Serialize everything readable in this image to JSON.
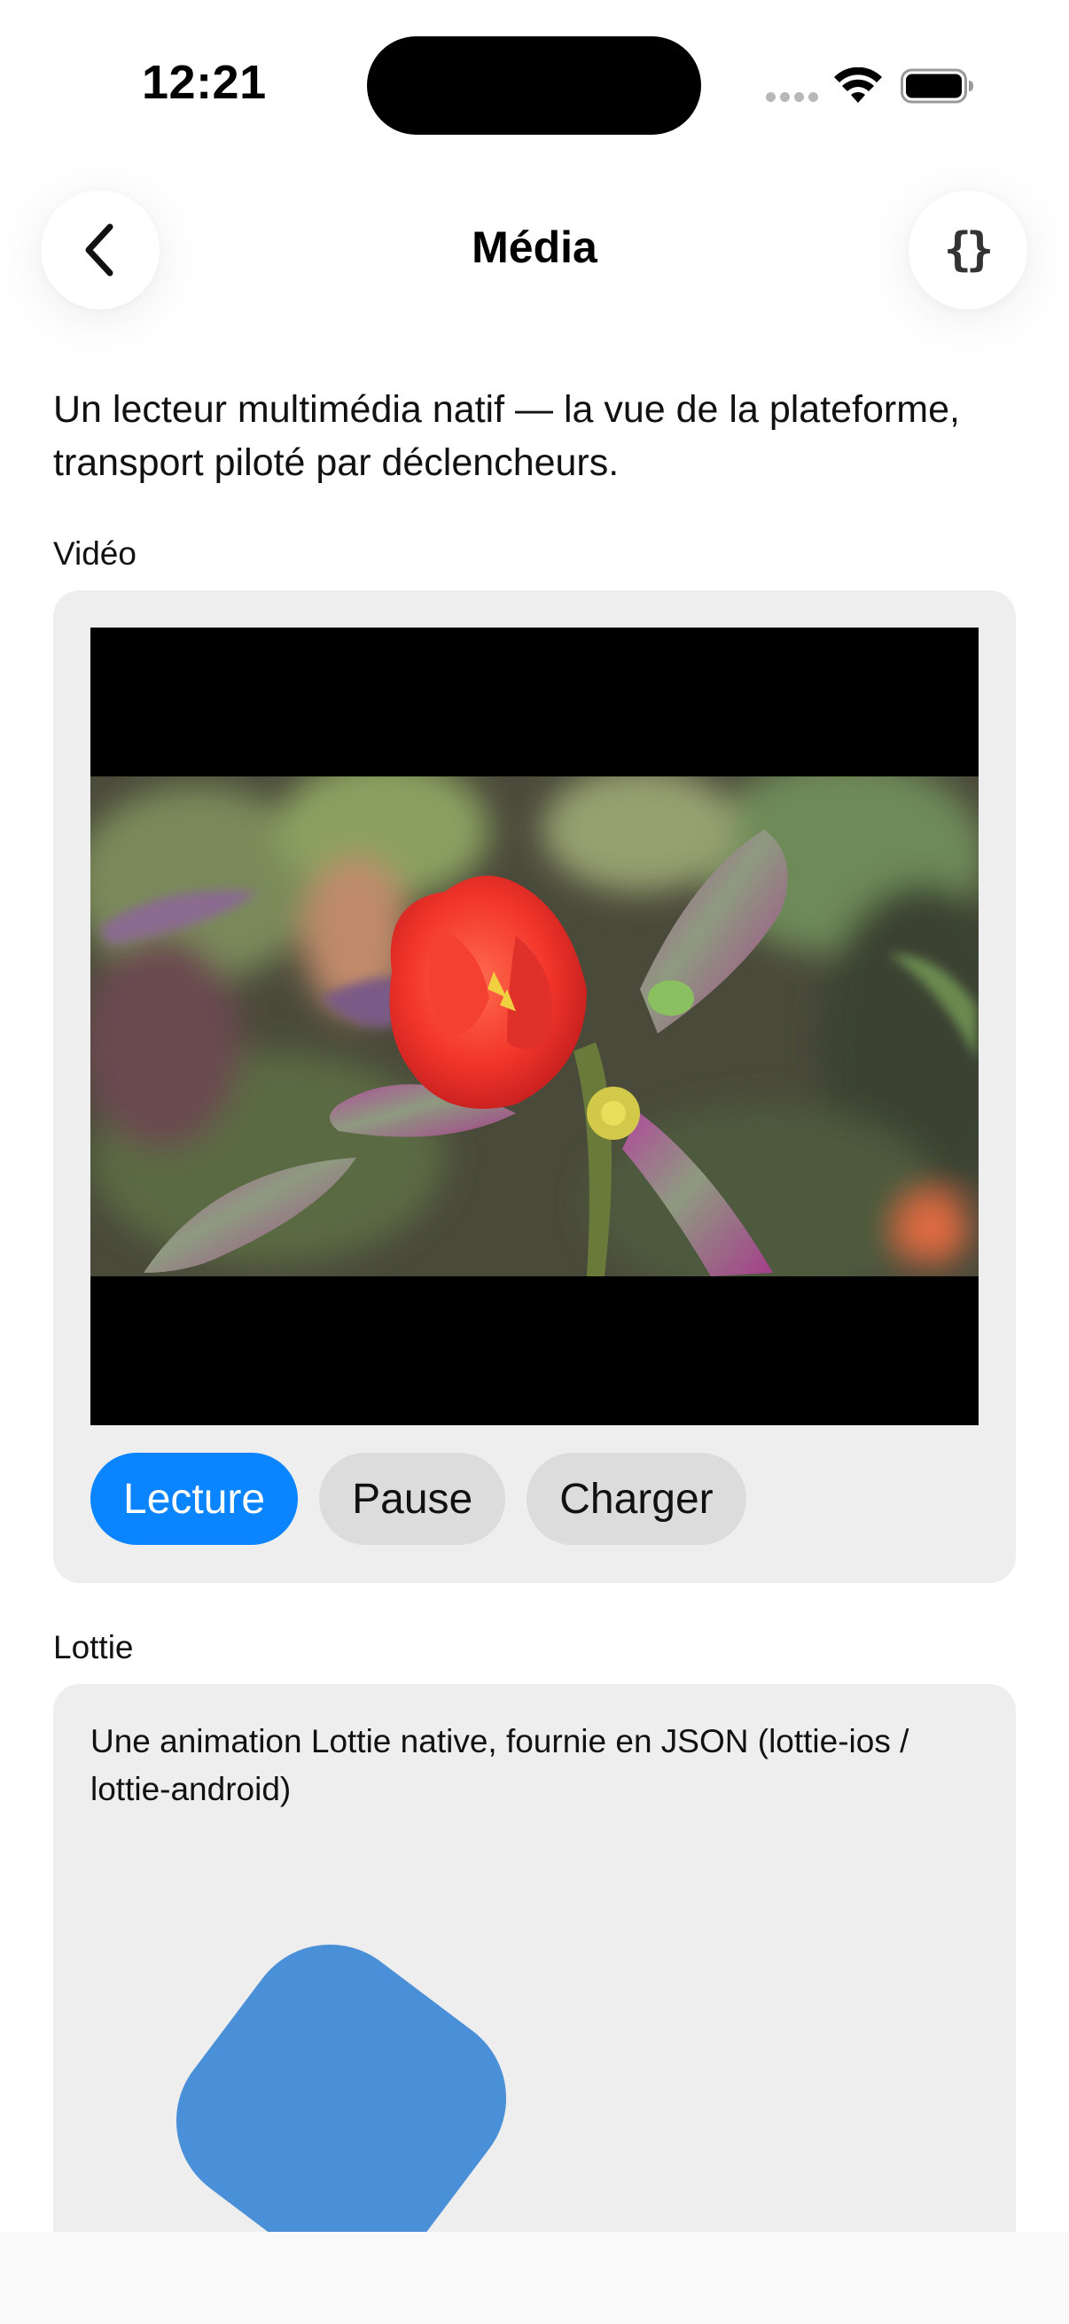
{
  "status_bar": {
    "time": "12:21"
  },
  "nav": {
    "title": "Média",
    "back_icon": "chevron-left-icon",
    "action_icon": "curly-braces-icon",
    "action_glyph": "{}"
  },
  "intro": "Un lecteur multimédia natif — la vue de la plateforme, transport piloté par déclencheurs.",
  "video_section": {
    "label": "Vidéo",
    "buttons": {
      "play": "Lecture",
      "pause": "Pause",
      "load": "Charger"
    }
  },
  "lottie_section": {
    "label": "Lottie",
    "description": "Une animation Lottie native, fournie en JSON (lottie-ios / lottie-android)",
    "shape_color": "#4a90d9"
  },
  "colors": {
    "accent": "#0a84ff",
    "card_bg": "#eeeeee"
  }
}
